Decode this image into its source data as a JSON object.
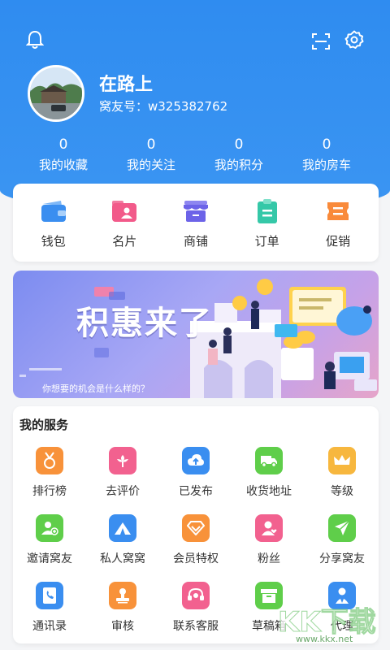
{
  "profile": {
    "name": "在路上",
    "id_text": "窝友号：w325382762"
  },
  "stats": [
    {
      "value": "0",
      "label": "我的收藏"
    },
    {
      "value": "0",
      "label": "我的关注"
    },
    {
      "value": "0",
      "label": "我的积分"
    },
    {
      "value": "0",
      "label": "我的房车"
    }
  ],
  "quick_actions": [
    {
      "label": "钱包",
      "icon": "wallet-icon",
      "color": "#3a8ef0"
    },
    {
      "label": "名片",
      "icon": "card-icon",
      "color": "#f25a8a"
    },
    {
      "label": "商铺",
      "icon": "shop-icon",
      "color": "#6c63e8"
    },
    {
      "label": "订单",
      "icon": "order-icon",
      "color": "#35c8a8"
    },
    {
      "label": "促销",
      "icon": "promo-icon",
      "color": "#f98a3a"
    }
  ],
  "banner": {
    "title": "积惠来了",
    "subtitle": "你想要的机会是什么样的？"
  },
  "services": {
    "title": "我的服务",
    "items": [
      {
        "label": "排行榜",
        "icon": "medal-icon",
        "color": "#f8923a"
      },
      {
        "label": "去评价",
        "icon": "flower-icon",
        "color": "#f2618f"
      },
      {
        "label": "已发布",
        "icon": "cloud-upload-icon",
        "color": "#3a8ef0"
      },
      {
        "label": "收货地址",
        "icon": "truck-icon",
        "color": "#5fce4a"
      },
      {
        "label": "等级",
        "icon": "crown-icon",
        "color": "#f7b73e"
      },
      {
        "label": "邀请窝友",
        "icon": "add-user-icon",
        "color": "#5fce4a"
      },
      {
        "label": "私人窝窝",
        "icon": "tent-icon",
        "color": "#3a8ef0"
      },
      {
        "label": "会员特权",
        "icon": "diamond-icon",
        "color": "#f8923a"
      },
      {
        "label": "粉丝",
        "icon": "fan-user-icon",
        "color": "#f2618f"
      },
      {
        "label": "分享窝友",
        "icon": "send-icon",
        "color": "#5fce4a"
      },
      {
        "label": "通讯录",
        "icon": "contacts-icon",
        "color": "#3a8ef0"
      },
      {
        "label": "审核",
        "icon": "stamp-icon",
        "color": "#f8923a"
      },
      {
        "label": "联系客服",
        "icon": "headset-icon",
        "color": "#f2618f"
      },
      {
        "label": "草稿箱",
        "icon": "box-icon",
        "color": "#5fce4a"
      },
      {
        "label": "代理",
        "icon": "agent-icon",
        "color": "#3a8ef0"
      }
    ]
  },
  "watermark": {
    "text": "KK下载",
    "url": "www.kkx.net"
  }
}
